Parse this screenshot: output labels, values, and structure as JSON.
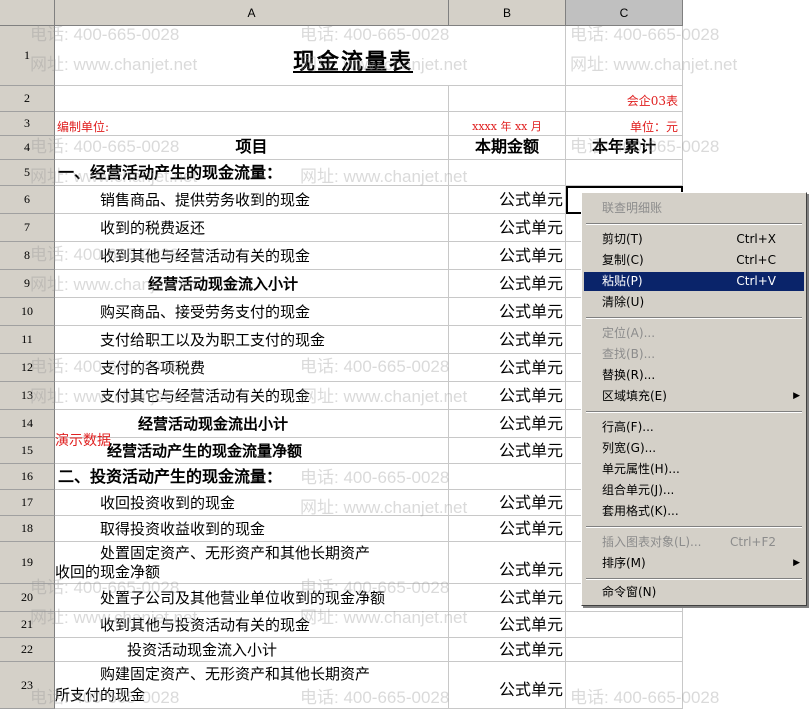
{
  "columns": [
    "A",
    "B",
    "C"
  ],
  "sheet": {
    "title": "现金流量表",
    "form_code": "会企03表",
    "unit_label": "编制单位:",
    "period": "xxxx 年 xx 月",
    "currency_unit": "单位：元",
    "header": {
      "item": "项目",
      "current": "本期金额",
      "ytd": "本年累计"
    },
    "demo_tag": "演示数据",
    "formula_text": "公式单元",
    "rows": [
      {
        "num": "1"
      },
      {
        "num": "2"
      },
      {
        "num": "3"
      },
      {
        "num": "4"
      },
      {
        "num": "5",
        "label": "一、经营活动产生的现金流量："
      },
      {
        "num": "6",
        "label": "销售商品、提供劳务收到的现金"
      },
      {
        "num": "7",
        "label": "收到的税费返还"
      },
      {
        "num": "8",
        "label": "收到其他与经营活动有关的现金"
      },
      {
        "num": "9",
        "label": "经营活动现金流入小计"
      },
      {
        "num": "10",
        "label": "购买商品、接受劳务支付的现金"
      },
      {
        "num": "11",
        "label": "支付给职工以及为职工支付的现金"
      },
      {
        "num": "12",
        "label": "支付的各项税费"
      },
      {
        "num": "13",
        "label": "支付其它与经营活动有关的现金"
      },
      {
        "num": "14",
        "label": "经营活动现金流出小计"
      },
      {
        "num": "15",
        "label": "经营活动产生的现金流量净额"
      },
      {
        "num": "16",
        "label": "二、投资活动产生的现金流量："
      },
      {
        "num": "17",
        "label": "收回投资收到的现金"
      },
      {
        "num": "18",
        "label": "取得投资收益收到的现金"
      },
      {
        "num": "19",
        "label_line1": "处置固定资产、无形资产和其他长期资产",
        "label_line2": "收回的现金净额"
      },
      {
        "num": "20",
        "label": "处置子公司及其他营业单位收到的现金净额"
      },
      {
        "num": "21",
        "label": "收到其他与投资活动有关的现金"
      },
      {
        "num": "22",
        "label": "投资活动现金流入小计"
      },
      {
        "num": "23",
        "label_line1": "购建固定资产、无形资产和其他长期资产",
        "label_line2": "所支付的现金"
      }
    ]
  },
  "watermark": {
    "phone": "电话: 400-665-0028",
    "site": "网址: www.chanjet.net"
  },
  "context_menu": {
    "items": [
      {
        "label": "联查明细账",
        "disabled": true
      },
      {
        "label": "剪切(T)",
        "shortcut": "Ctrl+X"
      },
      {
        "label": "复制(C)",
        "shortcut": "Ctrl+C"
      },
      {
        "label": "粘贴(P)",
        "shortcut": "Ctrl+V",
        "selected": true
      },
      {
        "label": "清除(U)"
      },
      {
        "label": "定位(A)...",
        "disabled": true
      },
      {
        "label": "查找(B)...",
        "disabled": true
      },
      {
        "label": "替换(R)..."
      },
      {
        "label": "区域填充(E)",
        "submenu": true
      },
      {
        "label": "行高(F)..."
      },
      {
        "label": "列宽(G)..."
      },
      {
        "label": "单元属性(H)..."
      },
      {
        "label": "组合单元(J)..."
      },
      {
        "label": "套用格式(K)..."
      },
      {
        "label": "插入图表对象(L)...",
        "shortcut": "Ctrl+F2",
        "disabled": true
      },
      {
        "label": "排序(M)",
        "submenu": true
      },
      {
        "label": "命令窗(N)"
      }
    ]
  },
  "colors": {
    "accent_red": "#e02020",
    "menu_highlight": "#0a246a",
    "chrome": "#d4d0c8"
  }
}
